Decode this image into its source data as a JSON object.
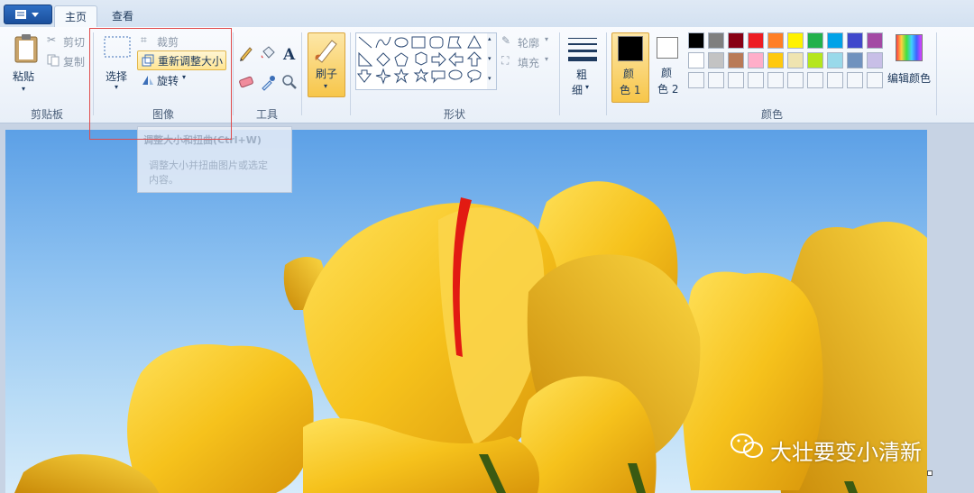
{
  "tabs": {
    "home": "主页",
    "view": "查看"
  },
  "clipboard": {
    "paste": "粘贴",
    "cut": "剪切",
    "copy": "复制",
    "group_label": "剪贴板"
  },
  "image": {
    "select": "选择",
    "crop": "裁剪",
    "resize": "重新调整大小",
    "rotate": "旋转",
    "group_label": "图像"
  },
  "tools": {
    "group_label": "工具"
  },
  "brushes": {
    "label": "刷子"
  },
  "shapes": {
    "outline": "轮廓",
    "fill": "填充",
    "group_label": "形状"
  },
  "size": {
    "label_line1": "粗",
    "label_line2": "细"
  },
  "colors": {
    "color1_line1": "颜",
    "color1_line2": "色 1",
    "color2_line1": "颜",
    "color2_line2": "色 2",
    "edit_colors": "编辑颜色",
    "group_label": "颜色",
    "palette_row1": [
      "#000000",
      "#7f7f7f",
      "#880015",
      "#ed1c24",
      "#ff7f27",
      "#fff200",
      "#22b14c",
      "#00a2e8",
      "#3f48cc",
      "#a349a4"
    ],
    "palette_row2": [
      "#ffffff",
      "#c3c3c3",
      "#b97a57",
      "#ffaec9",
      "#ffc90e",
      "#efe4b0",
      "#b5e61d",
      "#99d9ea",
      "#7092be",
      "#c8bfe7"
    ]
  },
  "tooltip": {
    "title": "调整大小和扭曲(Ctrl+W)",
    "body_line1": "调整大小并扭曲图片或选定",
    "body_line2": "内容。"
  },
  "watermark": {
    "text": "大壮要变小清新"
  }
}
